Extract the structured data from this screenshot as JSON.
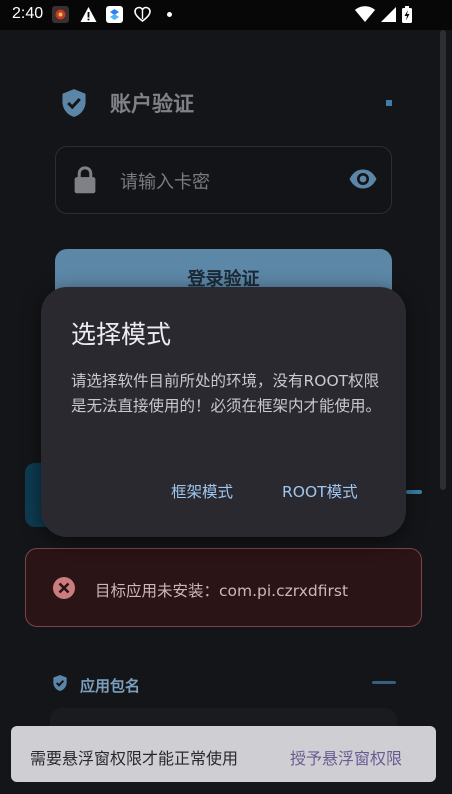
{
  "status_bar": {
    "time": "2:40",
    "icons": [
      "app-notification-icon",
      "warning-icon",
      "app-badge-icon",
      "health-icon",
      "wifi-icon",
      "signal-icon",
      "battery-icon"
    ]
  },
  "header": {
    "title": "账户验证",
    "icon": "shield-check-icon"
  },
  "password": {
    "placeholder": "请输入卡密",
    "lock_icon": "lock-icon",
    "visibility_icon": "eye-icon"
  },
  "login_button": {
    "label": "登录验证"
  },
  "dialog": {
    "title": "选择模式",
    "message": "请选择软件目前所处的环境，没有ROOT权限是无法直接使用的！必须在框架内才能使用。",
    "btn_frame": "框架模式",
    "btn_root": "ROOT模式"
  },
  "error": {
    "icon": "close-circle-icon",
    "text": "目标应用未安装：com.pi.czrxdfirst"
  },
  "package_section": {
    "label": "应用包名",
    "icon": "shield-check-icon"
  },
  "snackbar": {
    "message": "需要悬浮窗权限才能正常使用",
    "action": "授予悬浮窗权限"
  },
  "colors": {
    "accent": "#5c87a6",
    "dialog_bg": "#2a292f",
    "dialog_action": "#9ec6ee",
    "error_border": "#7d4446",
    "error_bg": "#2a1415",
    "background": "#141518"
  }
}
